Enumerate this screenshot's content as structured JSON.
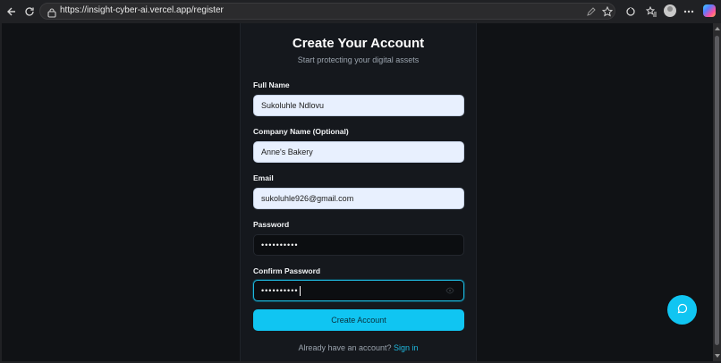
{
  "browser": {
    "url": "https://insight-cyber-ai.vercel.app/register",
    "icons": [
      "back-arrow-icon",
      "reload-icon",
      "lock-icon",
      "pen-icon",
      "star-icon",
      "extensions-icon",
      "favorites-icon",
      "profile-avatar",
      "more-icon",
      "copilot-icon"
    ]
  },
  "form": {
    "title": "Create Your Account",
    "subtitle": "Start protecting your digital assets",
    "fields": [
      {
        "label": "Full Name",
        "value": "Sukoluhle  Ndlovu"
      },
      {
        "label": "Company Name (Optional)",
        "value": "Anne's Bakery"
      },
      {
        "label": "Email",
        "value": "sukoluhle926@gmail.com"
      },
      {
        "label": "Password",
        "value": "••••••••••"
      },
      {
        "label": "Confirm Password",
        "value": "••••••••••"
      }
    ],
    "submit_label": "Create Account",
    "footer_text": "Already have an account?",
    "footer_link": "Sign in"
  },
  "colors": {
    "accent": "#10c5f2",
    "background": "#101215",
    "card": "#15181d"
  },
  "chat_icon": "chat-bubble-icon"
}
